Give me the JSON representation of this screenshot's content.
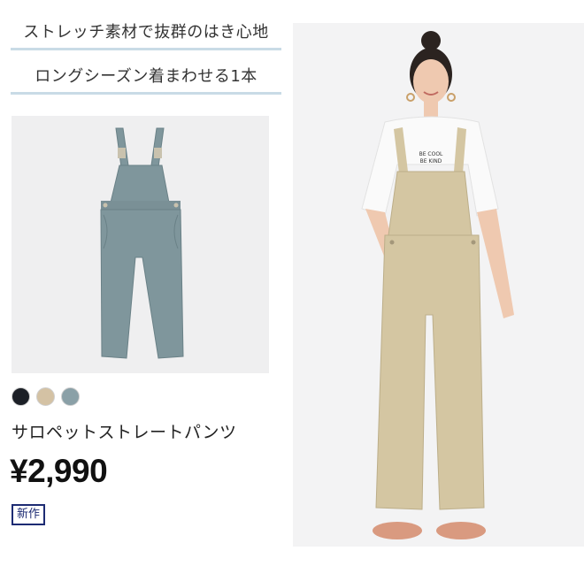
{
  "features": [
    "ストレッチ素材で抜群のはき心地",
    "ロングシーズン着まわせる1本"
  ],
  "product": {
    "name": "サロペットストレートパンツ",
    "price": "¥2,990",
    "badge": "新作",
    "swatches": [
      "#1c2027",
      "#d4c2a4",
      "#8aa0a7"
    ],
    "selected_color": "#7f969c"
  },
  "model_shirt_text": [
    "BE COOL",
    "BE KIND"
  ],
  "colors": {
    "feature_rule": "#c9dbe6",
    "badge": "#1d2b73"
  }
}
